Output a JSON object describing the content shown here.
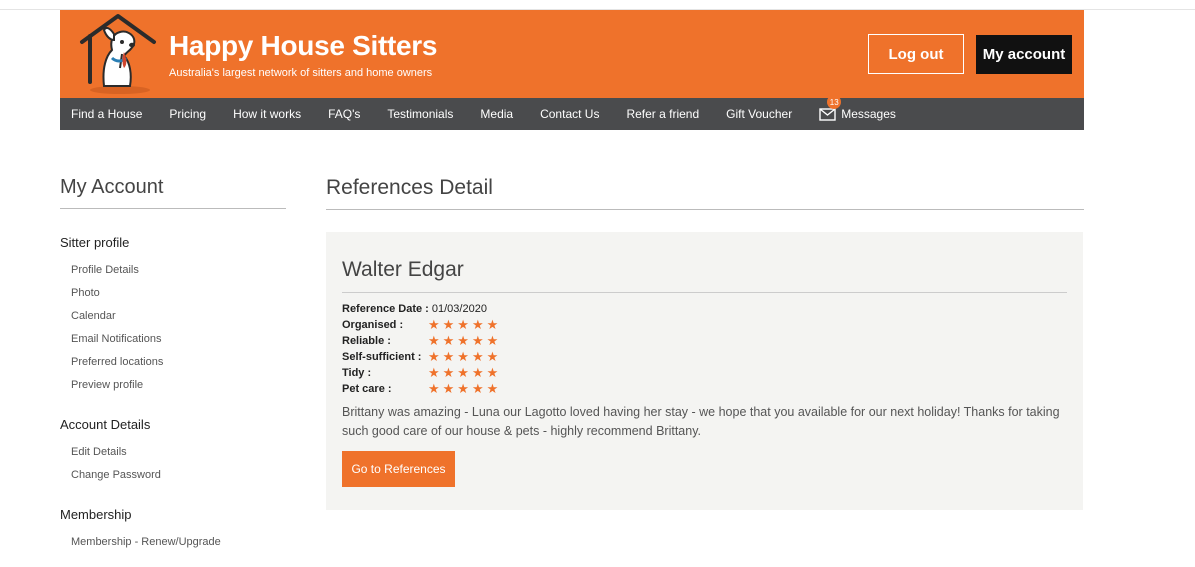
{
  "brand": {
    "title": "Happy House Sitters",
    "subtitle": "Australia's largest network of sitters and home owners"
  },
  "header": {
    "logout_label": "Log out",
    "account_label": "My account"
  },
  "nav": {
    "items": [
      {
        "label": "Find a House"
      },
      {
        "label": "Pricing"
      },
      {
        "label": "How it works"
      },
      {
        "label": "FAQ's"
      },
      {
        "label": "Testimonials"
      },
      {
        "label": "Media"
      },
      {
        "label": "Contact Us"
      },
      {
        "label": "Refer a friend"
      },
      {
        "label": "Gift Voucher"
      }
    ],
    "messages": {
      "label": "Messages",
      "count": "13",
      "icon": "mail-icon"
    }
  },
  "sidebar": {
    "title": "My Account",
    "sections": [
      {
        "title": "Sitter profile",
        "links": [
          "Profile Details",
          "Photo",
          "Calendar",
          "Email Notifications",
          "Preferred locations",
          "Preview profile"
        ]
      },
      {
        "title": "Account Details",
        "links": [
          "Edit Details",
          "Change Password"
        ]
      },
      {
        "title": "Membership",
        "links": [
          "Membership - Renew/Upgrade"
        ]
      }
    ]
  },
  "main": {
    "title": "References Detail",
    "reference": {
      "name": "Walter Edgar",
      "date_label": "Reference Date :",
      "date_value": "01/03/2020",
      "ratings": [
        {
          "label": "Organised :",
          "stars": 5
        },
        {
          "label": "Reliable :",
          "stars": 5
        },
        {
          "label": "Self-sufficient :",
          "stars": 5
        },
        {
          "label": "Tidy :",
          "stars": 5
        },
        {
          "label": "Pet care :",
          "stars": 5
        }
      ],
      "text": "Brittany was amazing - Luna our Lagotto loved having her stay - we hope that you available for our next holiday! Thanks for taking such good care of our house & pets - highly recommend Brittany.",
      "button_label": "Go to References"
    }
  },
  "colors": {
    "brand_orange": "#ef722b",
    "nav_gray": "#4a4b4d",
    "card_bg": "#f4f4f2"
  }
}
